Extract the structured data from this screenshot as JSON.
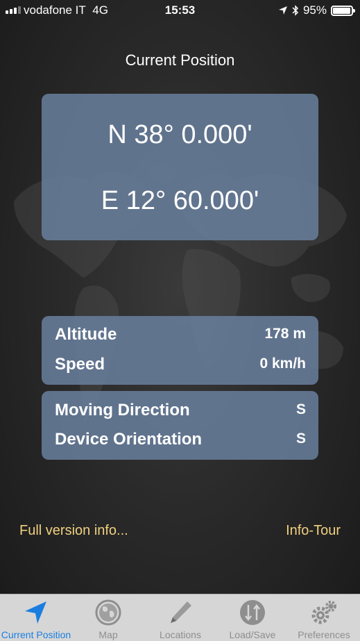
{
  "status_bar": {
    "carrier": "vodafone IT",
    "network": "4G",
    "time": "15:53",
    "battery": "95%"
  },
  "title": "Current Position",
  "coordinates": {
    "latitude": "N 38° 0.000'",
    "longitude": "E 12° 60.000'"
  },
  "motion": {
    "altitude_label": "Altitude",
    "altitude_value": "178 m",
    "speed_label": "Speed",
    "speed_value": "0 km/h"
  },
  "orientation": {
    "direction_label": "Moving Direction",
    "direction_value": "S",
    "device_label": "Device Orientation",
    "device_value": "S"
  },
  "links": {
    "full_version": "Full version info...",
    "info_tour": "Info-Tour"
  },
  "tabs": [
    {
      "label": "Current Position",
      "icon": "location-arrow-icon",
      "active": true
    },
    {
      "label": "Map",
      "icon": "globe-icon",
      "active": false
    },
    {
      "label": "Locations",
      "icon": "pencil-icon",
      "active": false
    },
    {
      "label": "Load/Save",
      "icon": "load-save-icon",
      "active": false
    },
    {
      "label": "Preferences",
      "icon": "gears-icon",
      "active": false
    }
  ],
  "colors": {
    "panel": "#687d9b",
    "link": "#f0d080",
    "tab_active": "#1a7ee0",
    "tab_inactive": "#8e8e8e"
  }
}
